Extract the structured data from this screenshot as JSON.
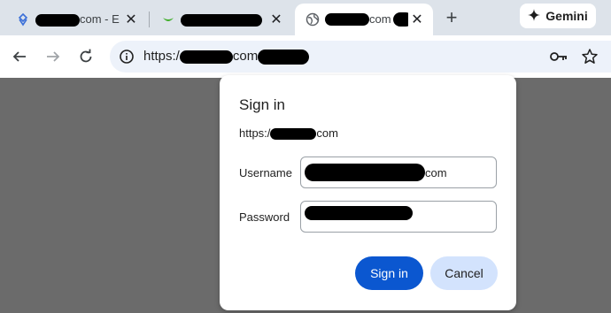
{
  "browser": {
    "tabs": [
      {
        "title_visible": "com - E",
        "active": false,
        "favicon": "app-logo-icon"
      },
      {
        "title_visible": "",
        "active": false,
        "favicon": "green-check-icon"
      },
      {
        "title_visible": "com",
        "active": true,
        "favicon": "globe-icon"
      }
    ],
    "close_glyph": "✕",
    "new_tab_glyph": "+",
    "gemini_label": "Gemini",
    "address": {
      "prefix": "https:/",
      "suffix": "com"
    }
  },
  "dialog": {
    "title": "Sign in",
    "origin_prefix": "https:/",
    "origin_suffix": "com",
    "username_label": "Username",
    "username_suffix": "com",
    "password_label": "Password",
    "sign_in_button": "Sign in",
    "cancel_button": "Cancel"
  },
  "colors": {
    "primary_button": "#0b57d0",
    "secondary_button": "#d3e3fd",
    "tabstrip": "#dde3ea",
    "backdrop": "#6b6b6b"
  }
}
